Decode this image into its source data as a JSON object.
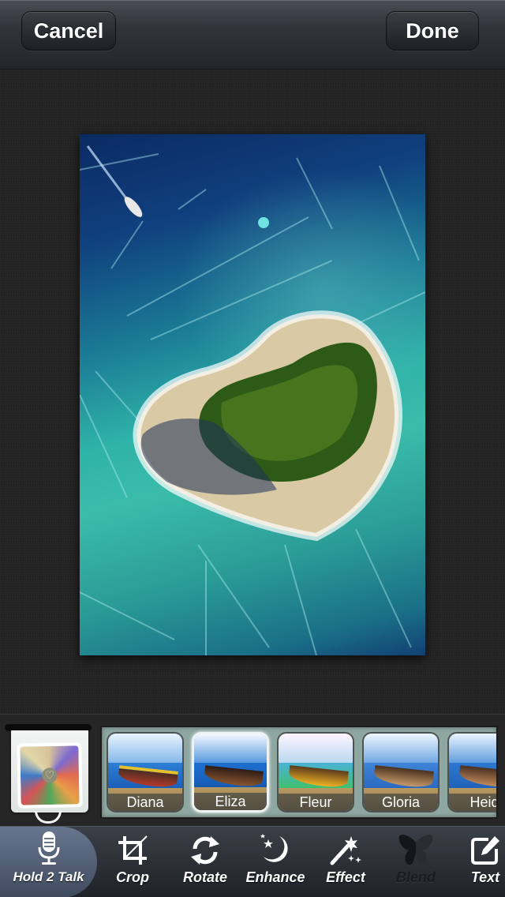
{
  "header": {
    "cancel_label": "Cancel",
    "done_label": "Done"
  },
  "photo": {
    "description": "Heart-shaped tropical island with palm trees, boat in deep blue water, scratched grunge overlay",
    "icon": "edited-photo"
  },
  "layer_holder": {
    "icon": "blend-layer-photo",
    "glyph": "♡"
  },
  "filters": {
    "selected": "Eliza",
    "items": [
      {
        "label": "Diana"
      },
      {
        "label": "Eliza"
      },
      {
        "label": "Fleur"
      },
      {
        "label": "Gloria"
      },
      {
        "label": "Heidi"
      }
    ]
  },
  "toolbar": {
    "items": [
      {
        "label": "Hold 2 Talk",
        "icon": "microphone-icon",
        "state": "active"
      },
      {
        "label": "Crop",
        "icon": "crop-icon",
        "state": "normal"
      },
      {
        "label": "Rotate",
        "icon": "rotate-icon",
        "state": "normal"
      },
      {
        "label": "Enhance",
        "icon": "moon-stars-icon",
        "state": "normal"
      },
      {
        "label": "Effect",
        "icon": "magic-wand-icon",
        "state": "normal"
      },
      {
        "label": "Blend",
        "icon": "butterfly-icon",
        "state": "disabled"
      },
      {
        "label": "Text",
        "icon": "edit-text-icon",
        "state": "normal"
      }
    ]
  },
  "colors": {
    "topbar": "#30343b",
    "canvas_bg": "#222222",
    "strip_bg": "#8fa7a1",
    "toolbar": "#2c3037",
    "active_tool": "#5a6780"
  }
}
